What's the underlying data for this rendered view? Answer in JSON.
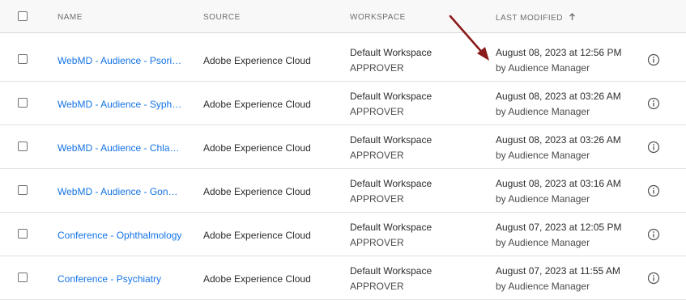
{
  "header": {
    "name": "NAME",
    "source": "SOURCE",
    "workspace": "WORKSPACE",
    "last_modified": "LAST MODIFIED"
  },
  "rows": [
    {
      "name": "WebMD - Audience - Psoria…",
      "source": "Adobe Experience Cloud",
      "workspace": "Default Workspace",
      "role": "APPROVER",
      "modified": "August 08, 2023 at 12:56 PM",
      "by": "by Audience Manager"
    },
    {
      "name": "WebMD - Audience - Syphilis",
      "source": "Adobe Experience Cloud",
      "workspace": "Default Workspace",
      "role": "APPROVER",
      "modified": "August 08, 2023 at 03:26 AM",
      "by": "by Audience Manager"
    },
    {
      "name": "WebMD - Audience - Chla…",
      "source": "Adobe Experience Cloud",
      "workspace": "Default Workspace",
      "role": "APPROVER",
      "modified": "August 08, 2023 at 03:26 AM",
      "by": "by Audience Manager"
    },
    {
      "name": "WebMD - Audience - Gonor…",
      "source": "Adobe Experience Cloud",
      "workspace": "Default Workspace",
      "role": "APPROVER",
      "modified": "August 08, 2023 at 03:16 AM",
      "by": "by Audience Manager"
    },
    {
      "name": "Conference - Ophthalmology",
      "source": "Adobe Experience Cloud",
      "workspace": "Default Workspace",
      "role": "APPROVER",
      "modified": "August 07, 2023 at 12:05 PM",
      "by": "by Audience Manager"
    },
    {
      "name": "Conference - Psychiatry",
      "source": "Adobe Experience Cloud",
      "workspace": "Default Workspace",
      "role": "APPROVER",
      "modified": "August 07, 2023 at 11:55 AM",
      "by": "by Audience Manager"
    }
  ],
  "icons": {
    "sort": "arrow-up-icon",
    "info": "info-icon",
    "annotation": "red-arrow-annotation"
  },
  "colors": {
    "link": "#1473e6",
    "annotation_arrow": "#8b1a1a",
    "header_bg": "#f8f8f8"
  }
}
